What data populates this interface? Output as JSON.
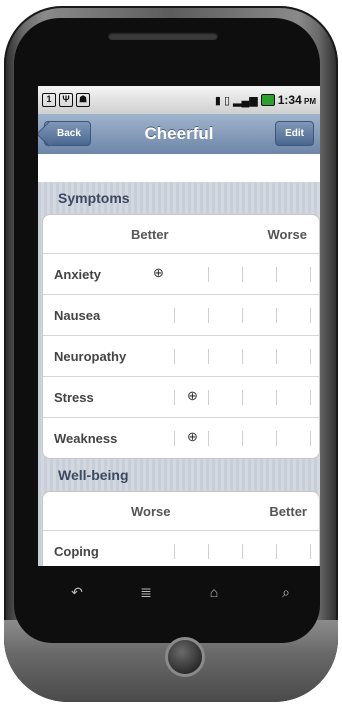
{
  "statusbar": {
    "icons_left": [
      "1",
      "usb",
      "android"
    ],
    "time": "1:34",
    "ampm": "PM"
  },
  "navbar": {
    "title": "Cheerful",
    "back_label": "Back",
    "edit_label": "Edit"
  },
  "sections": [
    {
      "title": "Symptoms",
      "left_header": "Better",
      "right_header": "Worse",
      "rows": [
        {
          "label": "Anxiety",
          "marker_pos": 0
        },
        {
          "label": "Nausea",
          "marker_pos": null
        },
        {
          "label": "Neuropathy",
          "marker_pos": null
        },
        {
          "label": "Stress",
          "marker_pos": 1
        },
        {
          "label": "Weakness",
          "marker_pos": 1
        }
      ]
    },
    {
      "title": "Well-being",
      "left_header": "Worse",
      "right_header": "Better",
      "rows": [
        {
          "label": "Coping",
          "marker_pos": null
        }
      ]
    }
  ],
  "marker_symbol": "⊕",
  "softkeys": [
    "back-icon",
    "menu-icon",
    "home-icon",
    "search-icon"
  ]
}
